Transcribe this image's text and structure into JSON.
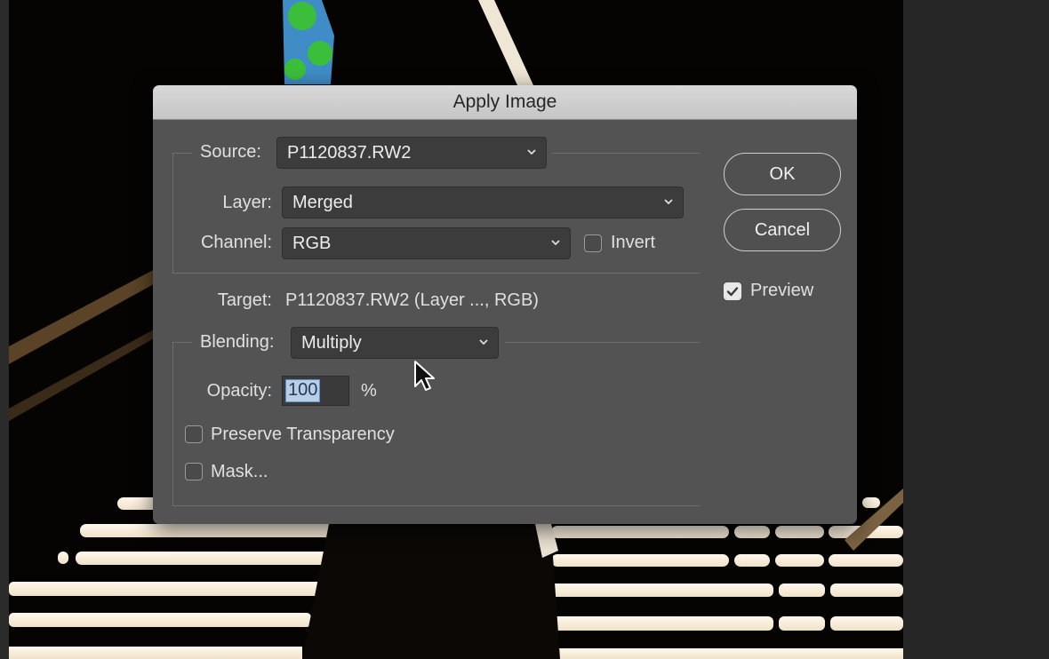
{
  "dialog": {
    "title": "Apply Image",
    "source": {
      "label": "Source:",
      "value": "P1120837.RW2"
    },
    "layer": {
      "label": "Layer:",
      "value": "Merged"
    },
    "channel": {
      "label": "Channel:",
      "value": "RGB"
    },
    "invert": {
      "label": "Invert",
      "checked": false
    },
    "target": {
      "label": "Target:",
      "value": "P1120837.RW2 (Layer ..., RGB)"
    },
    "blending": {
      "label": "Blending:",
      "value": "Multiply"
    },
    "opacity": {
      "label": "Opacity:",
      "value": "100",
      "unit": "%"
    },
    "preserve_transparency": {
      "label": "Preserve Transparency",
      "checked": false
    },
    "mask": {
      "label": "Mask...",
      "checked": false
    },
    "buttons": {
      "ok": "OK",
      "cancel": "Cancel"
    },
    "preview": {
      "label": "Preview",
      "checked": true
    }
  },
  "icons": {
    "dropdown": "chevron-down-icon",
    "checkmark": "checkmark-icon",
    "cursor": "mouse-pointer-icon"
  }
}
